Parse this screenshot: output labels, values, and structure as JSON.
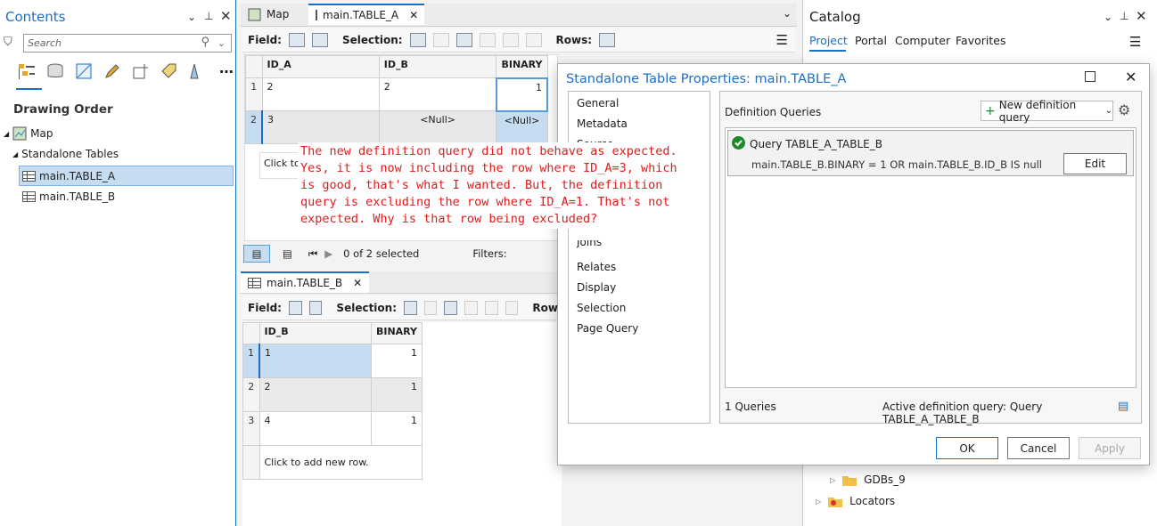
{
  "contents": {
    "title": "Contents",
    "search_placeholder": "Search",
    "drawing_order": "Drawing Order",
    "map": "Map",
    "standalone_tables": "Standalone Tables",
    "tables": [
      "main.TABLE_A",
      "main.TABLE_B"
    ]
  },
  "view_tabs": {
    "map": "Map",
    "table_a": "main.TABLE_A",
    "table_b": "main.TABLE_B"
  },
  "toolbar": {
    "field": "Field:",
    "selection": "Selection:",
    "rows": "Rows:",
    "rows_short": "Row"
  },
  "table_a": {
    "columns": [
      "ID_A",
      "ID_B",
      "BINARY"
    ],
    "rows": [
      {
        "n": "1",
        "id_a": "2",
        "id_b": "2",
        "binary": "1"
      },
      {
        "n": "2",
        "id_a": "3",
        "id_b": "<Null>",
        "binary": "<Null>"
      }
    ],
    "add_row": "Click to",
    "status": "0 of 2 selected",
    "filters": "Filters:"
  },
  "table_b": {
    "columns": [
      "ID_B",
      "BINARY"
    ],
    "rows": [
      {
        "n": "1",
        "id_b": "1",
        "binary": "1"
      },
      {
        "n": "2",
        "id_b": "2",
        "binary": "1"
      },
      {
        "n": "3",
        "id_b": "4",
        "binary": "1"
      }
    ],
    "add_row": "Click to add new row."
  },
  "annotation": "The new definition query did not behave as expected. Yes, it is now including the row where ID_A=3, which is good, that's what I wanted. But, the definition query is excluding the row where ID_A=1. That's not expected. Why is that row being excluded?",
  "catalog": {
    "title": "Catalog",
    "tabs": [
      "Project",
      "Portal",
      "Computer",
      "Favorites"
    ],
    "items": [
      "GDBs_9",
      "Locators"
    ]
  },
  "dialog": {
    "title": "Standalone Table Properties: main.TABLE_A",
    "nav": [
      "General",
      "Metadata",
      "Source",
      "Joins",
      "Relates",
      "Display",
      "Selection",
      "Page Query"
    ],
    "section": "Definition Queries",
    "new_query": "New definition query",
    "query_name": "Query TABLE_A_TABLE_B",
    "query_expr": "main.TABLE_B.BINARY = 1 OR main.TABLE_B.ID_B IS null",
    "edit": "Edit",
    "count": "1 Queries",
    "active": "Active definition query: Query TABLE_A_TABLE_B",
    "ok": "OK",
    "cancel": "Cancel",
    "apply": "Apply"
  },
  "colors": {
    "accent": "#1a6fc9",
    "annotation": "#e01b1b",
    "selection": "#c6ddf1",
    "success": "#1e8a2e"
  }
}
